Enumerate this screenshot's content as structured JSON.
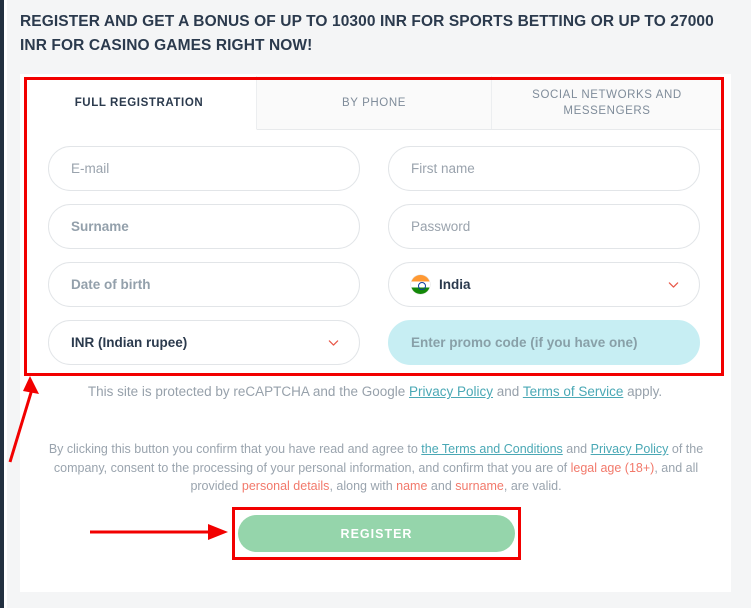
{
  "headline": "REGISTER AND GET A BONUS OF UP TO 10300 INR FOR SPORTS BETTING OR UP TO 27000 INR FOR CASINO GAMES RIGHT NOW!",
  "tabs": [
    {
      "label": "FULL REGISTRATION",
      "active": true
    },
    {
      "label": "BY PHONE",
      "active": false
    },
    {
      "label": "SOCIAL NETWORKS AND MESSENGERS",
      "active": false
    }
  ],
  "form": {
    "email": {
      "placeholder": "E-mail",
      "value": ""
    },
    "first_name": {
      "placeholder": "First name",
      "value": ""
    },
    "surname": {
      "placeholder": "Surname",
      "value": ""
    },
    "password": {
      "placeholder": "Password",
      "value": ""
    },
    "date_of_birth": {
      "placeholder": "Date of birth",
      "value": ""
    },
    "country": {
      "value": "India",
      "icon": "india-flag-icon",
      "chevron": "chevron-down-icon"
    },
    "currency": {
      "value": "INR (Indian rupee)",
      "chevron": "chevron-down-icon"
    },
    "promo_code": {
      "placeholder": "Enter promo code (if you have one)",
      "value": ""
    }
  },
  "recaptcha": {
    "part1": "This site is protected by reCAPTCHA and the Google ",
    "link1": "Privacy Policy",
    "part2": " and ",
    "link2": "Terms of Service",
    "part3": " apply."
  },
  "terms": {
    "part1": "By clicking this button you confirm that you have read and agree to ",
    "link1": "the Terms and Conditions",
    "part2": " and ",
    "link2": "Privacy Policy",
    "part3": " of the company, consent to the processing of your personal information, and confirm that you are of ",
    "hl1": "legal age (18+)",
    "part4": ", and all provided ",
    "hl2": "personal details",
    "part5": ", along with ",
    "hl3": "name",
    "part6": " and ",
    "hl4": "surname",
    "part7": ", are valid."
  },
  "register_button": {
    "label": "REGISTER"
  },
  "colors": {
    "headline_text": "#2b3a4d",
    "accent_green": "#95d5ab",
    "promo_bg": "#c7eef3",
    "link_teal": "#4aa8b5",
    "highlight_red": "#f2796b",
    "annotation_red": "#f20000",
    "chevron_red": "#e8594a"
  },
  "annotations": {
    "form_box": "red-rectangle-highlight",
    "button_box": "red-rectangle-highlight",
    "arrow_to_form": "red-arrow-up-right",
    "arrow_to_button": "red-arrow-right"
  }
}
